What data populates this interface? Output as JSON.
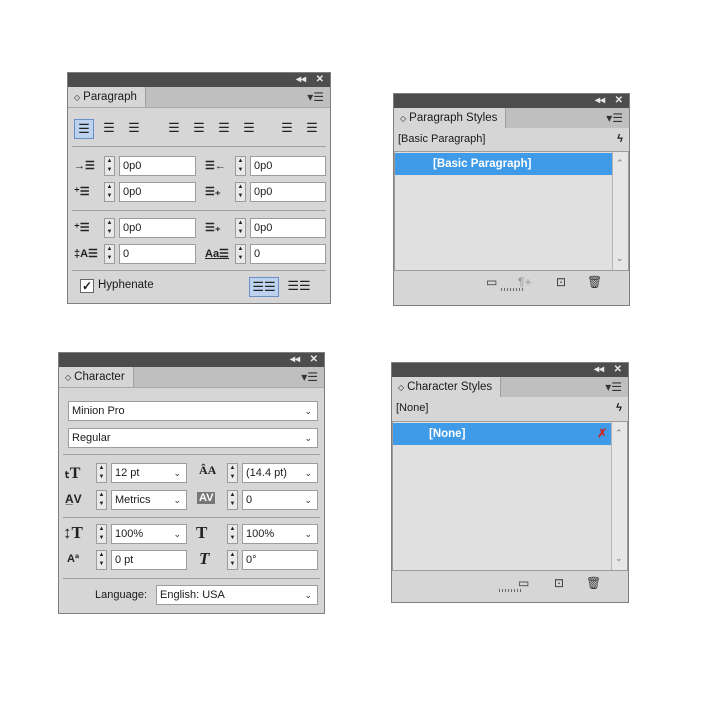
{
  "paragraph": {
    "title": "Paragraph",
    "left_indent": "0p0",
    "right_indent": "0p0",
    "first_line_indent": "0p0",
    "last_line_indent": "0p0",
    "space_before": "0p0",
    "space_after": "0p0",
    "drop_cap_lines": "0",
    "drop_cap_chars": "0",
    "hyphenate_label": "Hyphenate",
    "hyphenate_checked": "✓"
  },
  "paragraph_styles": {
    "title": "Paragraph Styles",
    "current": "[Basic Paragraph]",
    "items": [
      "[Basic Paragraph]"
    ]
  },
  "character": {
    "title": "Character",
    "font_family": "Minion Pro",
    "font_style": "Regular",
    "font_size": "12 pt",
    "leading": "(14.4 pt)",
    "kerning": "Metrics",
    "tracking": "0",
    "vertical_scale": "100%",
    "horizontal_scale": "100%",
    "baseline_shift": "0 pt",
    "skew": "0°",
    "language_label": "Language:",
    "language": "English: USA"
  },
  "character_styles": {
    "title": "Character Styles",
    "current": "[None]",
    "items": [
      "[None]"
    ]
  },
  "colors": {
    "selection": "#3f9be8",
    "panel": "#d6d6d6",
    "titlebar": "#4d4d4d"
  }
}
